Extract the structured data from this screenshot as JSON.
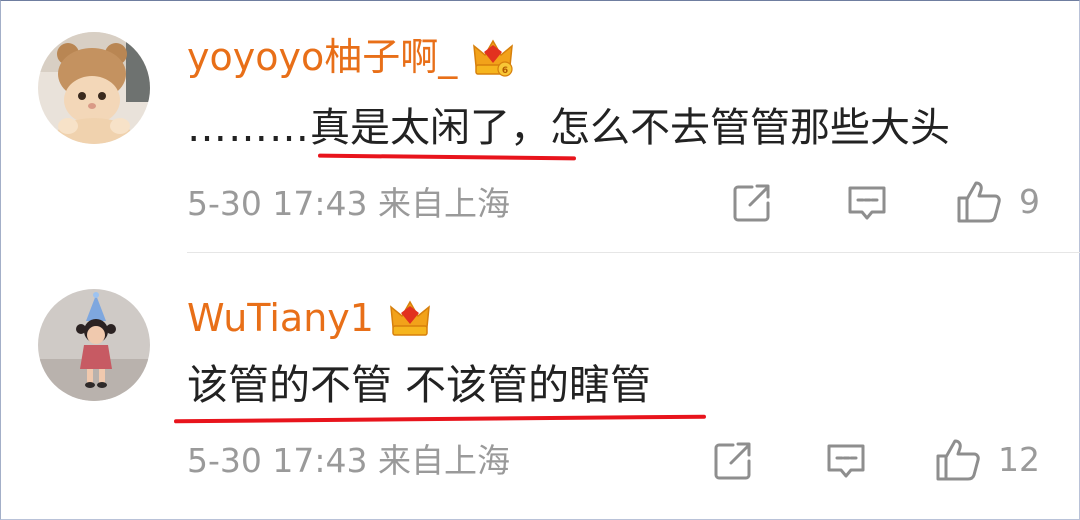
{
  "comments": [
    {
      "username": "yoyoyo柚子啊_",
      "badge": "crown-vip-icon",
      "text_prefix": "………",
      "text_highlight": "真是太闲了，",
      "text_rest": "怎么不去管管那些大头",
      "time": "5-30 17:43",
      "source": "来自上海",
      "likes": "9"
    },
    {
      "username": "WuTiany1",
      "badge": "crown-vip-icon",
      "text_highlight": "该管的不管 不该管的瞎管",
      "time": "5-30 17:43",
      "source": "来自上海",
      "likes": "12"
    }
  ],
  "colors": {
    "username": "#e86f18",
    "underline": "#e8141c",
    "meta": "#9a9a9a",
    "text": "#222222"
  }
}
